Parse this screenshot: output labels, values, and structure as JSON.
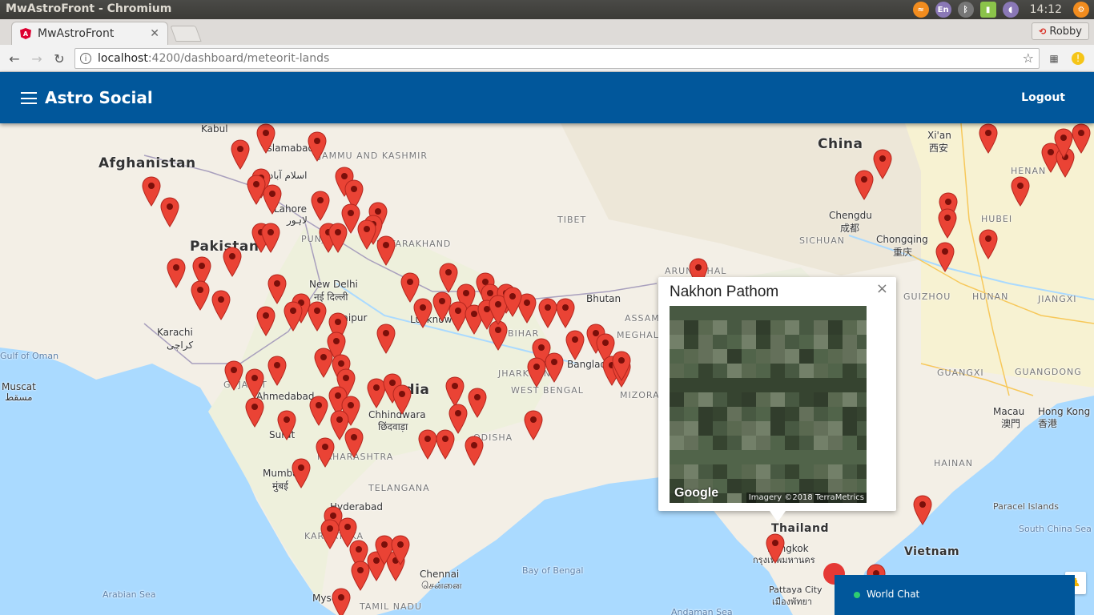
{
  "window": {
    "title": "MwAstroFront - Chromium",
    "clock": "14:12",
    "keyboard_layout": "En",
    "user": "Robby"
  },
  "browser": {
    "tab_title": "MwAstroFront",
    "url_host": "localhost",
    "url_rest": ":4200/dashboard/meteorit-lands"
  },
  "app": {
    "title": "Astro Social",
    "logout_label": "Logout"
  },
  "map": {
    "countries": [
      "Afghanistan",
      "Pakistan",
      "India",
      "China",
      "Thailand",
      "Vietnam"
    ],
    "regions": [
      "JAMMU AND KASHMIR",
      "PUNJAB",
      "UTTARAKHAND",
      "TIBET",
      "SICHUAN",
      "HUBEI",
      "HENAN",
      "HUNAN",
      "JIANGXI",
      "GUANGXI",
      "GUANGDONG",
      "BIHAR",
      "JHARKHAND",
      "WEST BENGAL",
      "ODISHA",
      "TELANGANA",
      "KARNATAKA",
      "TAMIL NADU",
      "MAHARASHTRA",
      "GUJARAT",
      "ASSAM",
      "MEGHALAYA",
      "MIZORAM",
      "ARUNACHAL",
      "GUIZHOU",
      "HAINAN"
    ],
    "cities": [
      "Kabul",
      "Islamabad",
      "اسلام آباد",
      "Lahore",
      "لاہور",
      "Karachi",
      "کراچی",
      "Muscat",
      "مسقط",
      "New Delhi",
      "नई दिल्ली",
      "Jaipur",
      "Ahmedabad",
      "Surat",
      "Mumbai",
      "मुंबई",
      "Chhindwara",
      "छिंदवाड़ा",
      "Hyderabad",
      "Chennai",
      "சென்னை",
      "Mysore",
      "Bangkok",
      "กรุงเทพมหานคร",
      "Pattaya City",
      "เมืองพัทยา",
      "Chengdu",
      "成都",
      "Chongqing",
      "重庆",
      "Xi'an",
      "西安",
      "Macau",
      "澳門",
      "Hong Kong",
      "香港",
      "Bhutan",
      "Lucknow",
      "Bangladesh"
    ],
    "seas": [
      "Gulf of Oman",
      "Arabian Sea",
      "Bay of Bengal",
      "Andaman Sea",
      "Paracel Islands",
      "South China Sea"
    ]
  },
  "popup": {
    "title": "Nakhon Pathom",
    "close_label": "×",
    "google_label": "Google",
    "imagery_credit": "Imagery ©2018 TerraMetrics"
  },
  "chat": {
    "label": "World Chat"
  }
}
